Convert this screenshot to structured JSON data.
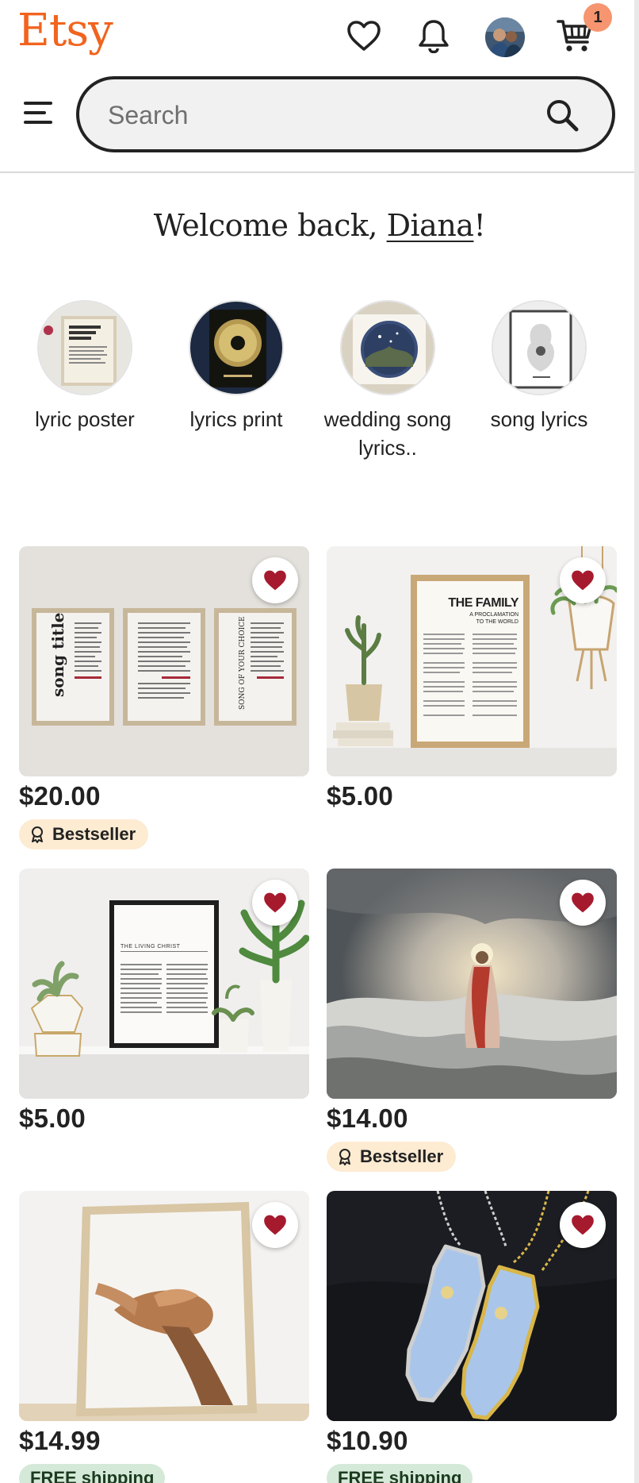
{
  "header": {
    "logo": "Etsy",
    "cart_count": "1",
    "search_placeholder": "Search"
  },
  "welcome": {
    "prefix": "Welcome back, ",
    "name": "Diana",
    "suffix": "!"
  },
  "categories": [
    {
      "label": "lyric poster"
    },
    {
      "label": "lyrics print"
    },
    {
      "label": "wedding song lyrics.."
    },
    {
      "label": "song lyrics"
    }
  ],
  "products": [
    {
      "price": "$20.00",
      "badge": "Bestseller"
    },
    {
      "price": "$5.00"
    },
    {
      "price": "$5.00"
    },
    {
      "price": "$14.00",
      "badge": "Bestseller"
    },
    {
      "price": "$14.99",
      "shipping": "FREE shipping"
    },
    {
      "price": "$10.90",
      "shipping": "FREE shipping"
    }
  ],
  "product_image_text": {
    "p1_left": "song title",
    "p1_right": "SONG OF YOUR CHOICE",
    "p2_title": "THE FAMILY",
    "p2_sub1": "A PROCLAMATION",
    "p2_sub2": "TO THE WORLD",
    "p3_title": "THE LIVING CHRIST"
  },
  "colors": {
    "brand": "#F1641E",
    "heart": "#A61A2E",
    "bestseller_bg": "#FDEBD2",
    "shipping_bg": "#D4E9D7"
  }
}
